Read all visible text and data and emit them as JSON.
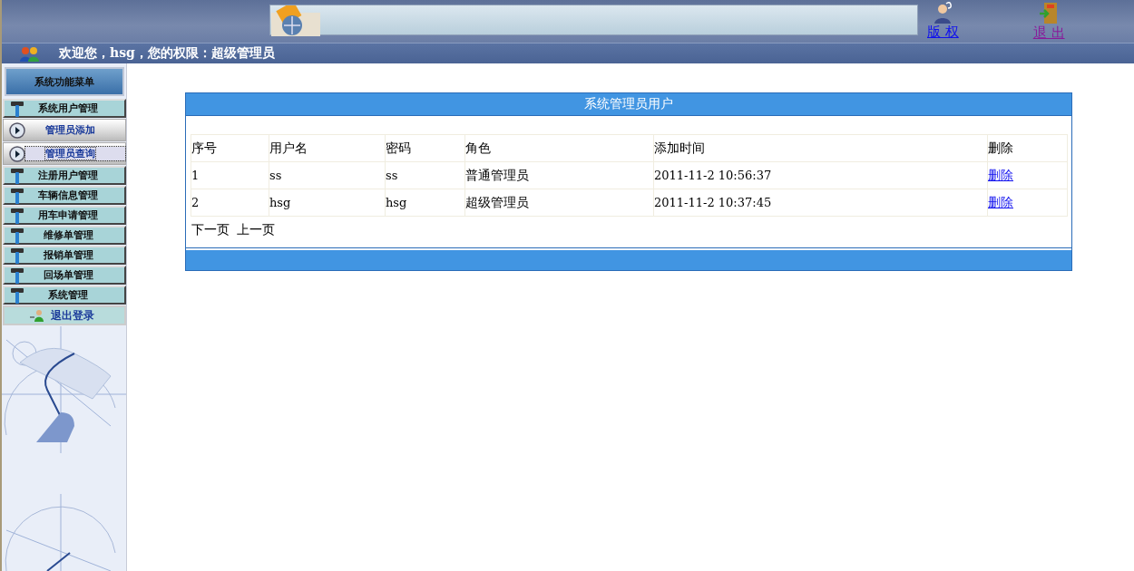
{
  "header": {
    "links": [
      {
        "label": "版 权",
        "kind": "copyright",
        "visited": false
      },
      {
        "label": "退 出",
        "kind": "exit",
        "visited": true
      }
    ]
  },
  "welcome": "欢迎您，hsg，您的权限：超级管理员",
  "sidebar": {
    "title": "系统功能菜单",
    "items": [
      {
        "label": "系统用户管理",
        "kind": "group",
        "selected": false
      },
      {
        "label": "管理员添加",
        "kind": "sub",
        "selected": false
      },
      {
        "label": "管理员查询",
        "kind": "sub",
        "selected": true
      },
      {
        "label": "注册用户管理",
        "kind": "group",
        "selected": false
      },
      {
        "label": "车辆信息管理",
        "kind": "group",
        "selected": false
      },
      {
        "label": "用车申请管理",
        "kind": "group",
        "selected": false
      },
      {
        "label": "维修单管理",
        "kind": "group",
        "selected": false
      },
      {
        "label": "报销单管理",
        "kind": "group",
        "selected": false
      },
      {
        "label": "回场单管理",
        "kind": "group",
        "selected": false
      },
      {
        "label": "系统管理",
        "kind": "group",
        "selected": false
      },
      {
        "label": "退出登录",
        "kind": "logout",
        "selected": false
      }
    ]
  },
  "panel": {
    "title": "系统管理员用户",
    "table": {
      "columns": [
        "序号",
        "用户名",
        "密码",
        "角色",
        "添加时间",
        "删除"
      ],
      "rows": [
        {
          "cells": [
            "1",
            "ss",
            "ss",
            "普通管理员",
            "2011-11-2 10:56:37"
          ],
          "action": "删除"
        },
        {
          "cells": [
            "2",
            "hsg",
            "hsg",
            "超级管理员",
            "2011-11-2 10:37:45"
          ],
          "action": "删除"
        }
      ]
    },
    "pager": [
      "下一页",
      "上一页"
    ]
  }
}
